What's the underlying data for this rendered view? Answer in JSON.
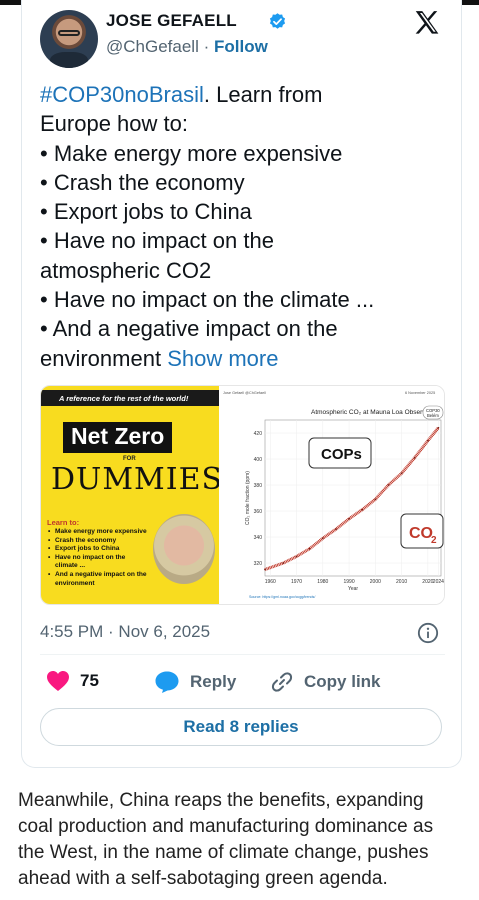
{
  "author": {
    "name": "JOSE GEFAELL",
    "handle": "@ChGefaell",
    "separator": "·",
    "follow_label": "Follow"
  },
  "tweet": {
    "lines": [
      {
        "hashtag": "#COP30noBrasil",
        "text": ". Learn from"
      },
      {
        "text": "Europe how to:"
      },
      {
        "text": "• Make energy more expensive"
      },
      {
        "text": "• Crash the economy"
      },
      {
        "text": "• Export jobs to China"
      },
      {
        "text": "• Have no impact on the"
      },
      {
        "text": "atmospheric CO2"
      },
      {
        "text": "• Have no impact on the climate ..."
      },
      {
        "text": "• And a negative impact on the"
      },
      {
        "text": "environment ",
        "link": "Show more"
      }
    ]
  },
  "media": {
    "book": {
      "tagline": "A reference for the rest of the world!",
      "title": "Net Zero",
      "for": "FOR",
      "brand": "DUMMIES",
      "learn_label": "Learn to:",
      "bullets": [
        "Make energy more expensive",
        "Crash the economy",
        "Export jobs to China",
        "Have no impact on the climate ...",
        "And a negative impact on the environment"
      ]
    },
    "chart": {
      "header_left": "Jose Gefaell @ChGefaell",
      "header_right": "6 November 2025",
      "title": "Atmospheric CO₂ at Mauna Loa Observatory",
      "badge_top": "COP30",
      "badge_bottom": "Belém",
      "callout_cops": "COPs",
      "callout_co2": "CO",
      "callout_co2_sub": "2",
      "source": "Source: https://gml.noaa.gov/ccgg/trends/"
    }
  },
  "chart_data": {
    "type": "line",
    "title": "Atmospheric CO₂ at Mauna Loa Observatory",
    "xlabel": "Year",
    "ylabel": "CO₂ mole fraction (ppm)",
    "xlim": [
      1958,
      2025
    ],
    "ylim": [
      310,
      430
    ],
    "x_ticks": [
      1960,
      1970,
      1980,
      1990,
      2000,
      2010,
      2020,
      2024
    ],
    "y_ticks": [
      320,
      340,
      360,
      380,
      400,
      420
    ],
    "series": [
      {
        "x": [
          1958,
          1965,
          1970,
          1975,
          1980,
          1985,
          1990,
          1995,
          2000,
          2005,
          2010,
          2015,
          2020,
          2024
        ],
        "values": [
          315,
          320,
          325,
          331,
          339,
          346,
          354,
          361,
          369,
          380,
          389,
          401,
          414,
          424
        ],
        "color": "#c0392b"
      }
    ],
    "grid": true
  },
  "meta": {
    "timestamp": "4:55 PM · Nov 6, 2025"
  },
  "actions": {
    "likes": "75",
    "reply_label": "Reply",
    "copy_label": "Copy link",
    "read_label": "Read 8 replies"
  },
  "caption": {
    "lines": [
      "Meanwhile, China reaps the benefits, expanding",
      "coal production and manufacturing dominance as",
      "the West, in the name of climate change, pushes",
      "ahead with a self-sabotaging green agenda."
    ]
  },
  "colors": {
    "link": "#1d73b8",
    "heart": "#f91880",
    "reply_bubble": "#1d9bf0",
    "verified": "#1d9bf0"
  }
}
